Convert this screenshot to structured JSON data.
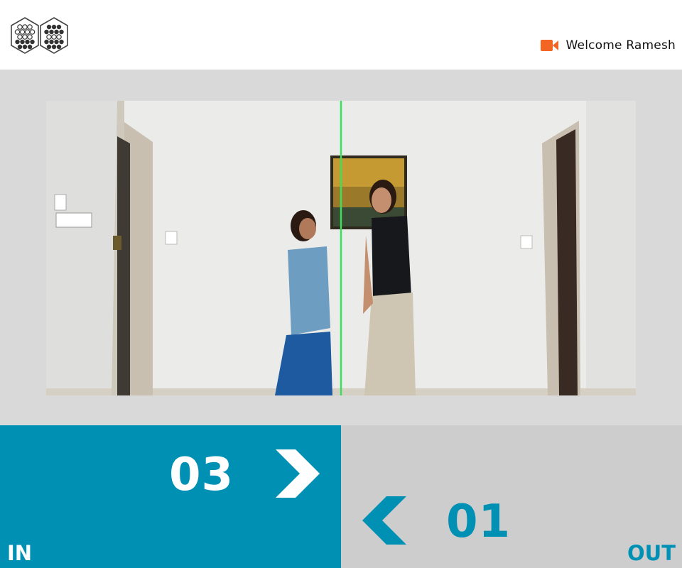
{
  "header": {
    "logo_icon": "hexagon-dots-logo",
    "camera_icon": "video-camera-icon",
    "camera_color": "#f26522",
    "welcome_text": "Welcome Ramesh"
  },
  "feed": {
    "line_color": "#39e05a",
    "description_icon": "live-camera-feed"
  },
  "counters": {
    "in": {
      "label": "IN",
      "count": "03",
      "arrow_icon": "chevron-right-icon",
      "color": "#0090b4"
    },
    "out": {
      "label": "OUT",
      "count": "01",
      "arrow_icon": "chevron-left-icon",
      "color": "#cdcdcd"
    }
  }
}
